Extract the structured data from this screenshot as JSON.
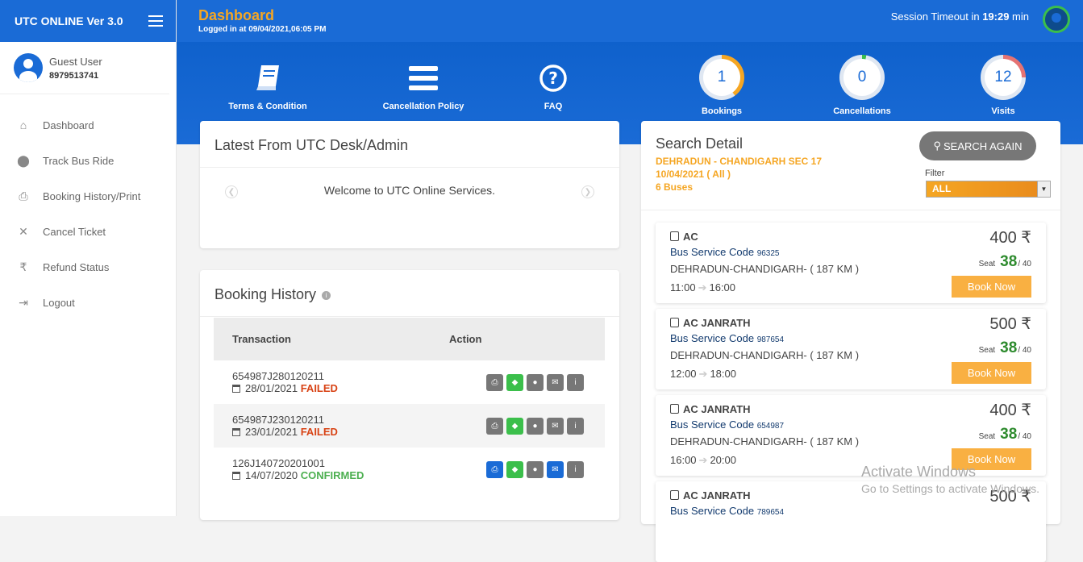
{
  "brand": {
    "title": "UTC ONLINE Ver 3.0"
  },
  "user": {
    "name": "Guest User",
    "phone": "8979513741"
  },
  "nav": [
    {
      "label": "Dashboard",
      "icon": "home-icon"
    },
    {
      "label": "Track Bus Ride",
      "icon": "map-pin-icon"
    },
    {
      "label": "Booking History/Print",
      "icon": "printer-icon"
    },
    {
      "label": "Cancel Ticket",
      "icon": "close-icon"
    },
    {
      "label": "Refund Status",
      "icon": "rupee-icon"
    },
    {
      "label": "Logout",
      "icon": "logout-icon"
    }
  ],
  "header": {
    "title": "Dashboard",
    "logged": "Logged in at 09/04/2021,06:05 PM",
    "session_prefix": "Session Timeout in ",
    "session_time": "19:29",
    "session_suffix": " min"
  },
  "hero": {
    "links": [
      {
        "label": "Terms & Condition",
        "icon": "book-icon"
      },
      {
        "label": "Cancellation Policy",
        "icon": "list-icon"
      },
      {
        "label": "FAQ",
        "icon": "question-icon"
      }
    ],
    "stats": [
      {
        "label": "Bookings",
        "value": "1",
        "fraction": 0.4,
        "color": "#f5a623"
      },
      {
        "label": "Cancellations",
        "value": "0",
        "fraction": 0.03,
        "color": "#3bbf4b"
      },
      {
        "label": "Visits",
        "value": "12",
        "fraction": 0.25,
        "color": "#e57373"
      }
    ]
  },
  "news": {
    "title": "Latest From UTC Desk/Admin",
    "message": "Welcome to UTC Online Services."
  },
  "history": {
    "title": "Booking History",
    "col_transaction": "Transaction",
    "col_action": "Action",
    "rows": [
      {
        "id": "654987J280120211",
        "date": "28/01/2021",
        "status": "FAILED"
      },
      {
        "id": "654987J230120211",
        "date": "23/01/2021",
        "status": "FAILED"
      },
      {
        "id": "126J140720201001",
        "date": "14/07/2020",
        "status": "CONFIRMED"
      }
    ]
  },
  "search": {
    "title": "Search Detail",
    "route": "DEHRADUN - CHANDIGARH SEC 17",
    "date": "10/04/2021 ( All )",
    "buses": "6 Buses",
    "again_label": "SEARCH AGAIN",
    "filter_label": "Filter",
    "filter_value": "ALL",
    "results": [
      {
        "type": "AC",
        "code_label": "Bus Service Code",
        "code": "96325",
        "dest": "DEHRADUN-CHANDIGARH- ( 187 KM )",
        "dep": "11:00",
        "arr": "16:00",
        "price": "400",
        "seat_label": "Seat",
        "seats": "38",
        "total": "/ 40",
        "book": "Book Now"
      },
      {
        "type": "AC JANRATH",
        "code_label": "Bus Service Code",
        "code": "987654",
        "dest": "DEHRADUN-CHANDIGARH- ( 187 KM )",
        "dep": "12:00",
        "arr": "18:00",
        "price": "500",
        "seat_label": "Seat",
        "seats": "38",
        "total": "/ 40",
        "book": "Book Now"
      },
      {
        "type": "AC JANRATH",
        "code_label": "Bus Service Code",
        "code": "654987",
        "dest": "DEHRADUN-CHANDIGARH- ( 187 KM )",
        "dep": "16:00",
        "arr": "20:00",
        "price": "400",
        "seat_label": "Seat",
        "seats": "38",
        "total": "/ 40",
        "book": "Book Now"
      },
      {
        "type": "AC JANRATH",
        "code_label": "Bus Service Code",
        "code": "789654",
        "dest": "",
        "dep": "",
        "arr": "",
        "price": "500",
        "seat_label": "",
        "seats": "",
        "total": "",
        "book": ""
      }
    ]
  },
  "watermark": {
    "title": "Activate Windows",
    "sub": "Go to Settings to activate Windows."
  }
}
